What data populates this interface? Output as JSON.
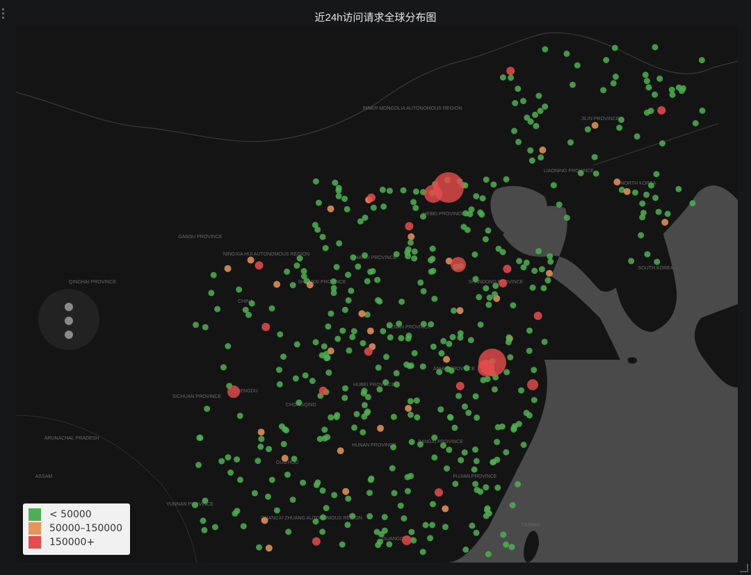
{
  "panel": {
    "title": "近24h访问请求全球分布图"
  },
  "legend": {
    "items": [
      {
        "label": "< 50000",
        "color": "#4caf50"
      },
      {
        "label": "50000–150000",
        "color": "#e8955a"
      },
      {
        "label": "150000+",
        "color": "#e74c4c"
      }
    ]
  },
  "map": {
    "region_labels": [
      "CHINA",
      "SOUTH KOREA",
      "NORTH KOREA",
      "TAIWAN",
      "HEBEI PROVINCE",
      "SHANXI PROVINCE",
      "SHAANXI PROVINCE",
      "HENAN PROVINCE",
      "HUBEI PROVINCE",
      "HUNAN PROVINCE",
      "SICHUAN PROVINCE",
      "GANSU PROVINCE",
      "QINGHAI PROVINCE",
      "NINGXIA HUI AUTONOMOUS REGION",
      "INNER MONGOLIA AUTONOMOUS REGION",
      "ANHUI PROVINCE",
      "JIANGXI PROVINCE",
      "FUJIAN PROVINCE",
      "GUANGXI ZHUANG AUTONOMOUS REGION",
      "GUIZHOU",
      "YUNNAN PROVINCE",
      "SHANDONG PROVINCE",
      "LIAONING PROVINCE",
      "JILIN PROVINCE",
      "ARUNACHAL PRADESH",
      "ASSAM",
      "CHONGQING",
      "GUANGDONG",
      "CHENGDU"
    ],
    "zoom_label": "zoom"
  },
  "colors": {
    "low": "#4caf50",
    "mid": "#e8955a",
    "high": "#e74c4c",
    "land": "#121212",
    "sea": "#4a4a4a"
  }
}
